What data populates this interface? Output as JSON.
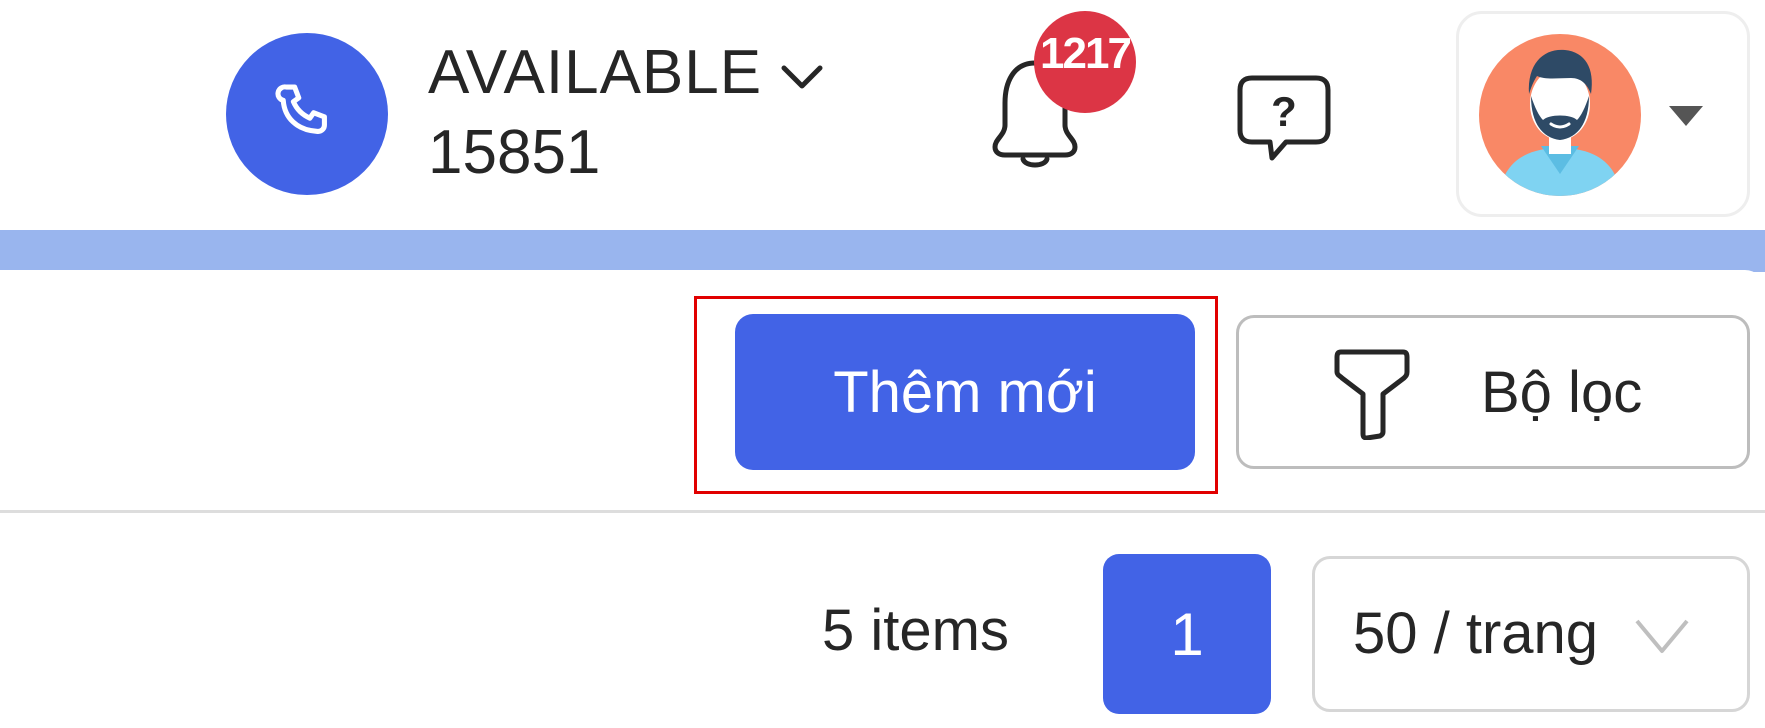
{
  "header": {
    "status": "AVAILABLE",
    "extension": "15851",
    "notification_count": "1217",
    "phone_icon": "phone-icon",
    "bell_icon": "bell-icon",
    "help_icon": "help-chat-icon",
    "avatar": "user-avatar"
  },
  "toolbar": {
    "add_new_label": "Thêm mới",
    "filter_label": "Bộ lọc",
    "filter_icon": "filter-icon"
  },
  "pagination": {
    "total_label": "5 items",
    "current_page": "1",
    "page_size_label": "50 / trang"
  },
  "colors": {
    "primary": "#4263e6",
    "band": "#99b5ee",
    "badge": "#dc3545",
    "highlight": "#e10000",
    "avatar_bg": "#f98866"
  }
}
